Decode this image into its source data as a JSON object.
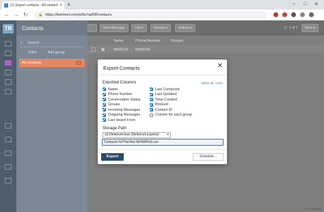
{
  "browser": {
    "tab_title": "(1) Export contacts - All contacts",
    "tab_close": "×",
    "new_tab": "+",
    "url": "https://telerivet.com/p/5e7adf3f/contacts",
    "nav_back": "←",
    "nav_forward": "→",
    "nav_reload": "↻",
    "lock": "🔒",
    "win_min": "–",
    "win_max": "□",
    "win_close": "✕",
    "favicon": "T"
  },
  "nav": {
    "logo": "TR"
  },
  "sidebar": {
    "title": "Contacts",
    "search_placeholder": "Search",
    "filter_label": "Filter",
    "add_group_label": "Add group",
    "all_contacts_label": "All contacts",
    "all_contacts_count": "1"
  },
  "toolbar": {
    "new_message": "New Message",
    "call": "Call ▾",
    "groups": "Groups ▾",
    "actions": "Actions ▾",
    "pager": "1 - 1 of 1",
    "more": "More ▾"
  },
  "table": {
    "headers": [
      "Name",
      "Phone Number",
      "Groups"
    ],
    "rows": [
      {
        "name": "5550123",
        "phone": "5550123",
        "groups": ""
      }
    ]
  },
  "status": {
    "text": "Live updates"
  },
  "modal": {
    "title": "Export Contacts",
    "close": "✕",
    "columns_label": "Exported Columns",
    "select_all": "select all",
    "select_sep": "/",
    "select_none": "none",
    "columns_left": [
      {
        "label": "Name",
        "checked": true
      },
      {
        "label": "Phone Number",
        "checked": true
      },
      {
        "label": "Conversation Status",
        "checked": true
      },
      {
        "label": "Groups",
        "checked": true
      },
      {
        "label": "Incoming Messages",
        "checked": true
      },
      {
        "label": "Outgoing Messages",
        "checked": true
      },
      {
        "label": "Last Heard From",
        "checked": true
      }
    ],
    "columns_right": [
      {
        "label": "Last Contacted",
        "checked": true
      },
      {
        "label": "Last Updated",
        "checked": true
      },
      {
        "label": "Time Created",
        "checked": true
      },
      {
        "label": "Blocked",
        "checked": true
      },
      {
        "label": "Contact ID",
        "checked": true
      },
      {
        "label": "Column for each group",
        "checked": false
      }
    ],
    "storage_label": "Storage Path",
    "storage_value": "s3://telerivet-test-2/telerivet-exports/",
    "storage_caret": "▾",
    "filename_value": "Contacts-%Y%m%d-%H%M%S.csv",
    "export_button": "Export",
    "schedule_button": "Schedule..."
  },
  "colors": {
    "modal_primary": "#2b4a6b",
    "checkbox": "#1f6fb8",
    "active_group": "#e8875f",
    "nav_bg": "#4f5d6b"
  }
}
